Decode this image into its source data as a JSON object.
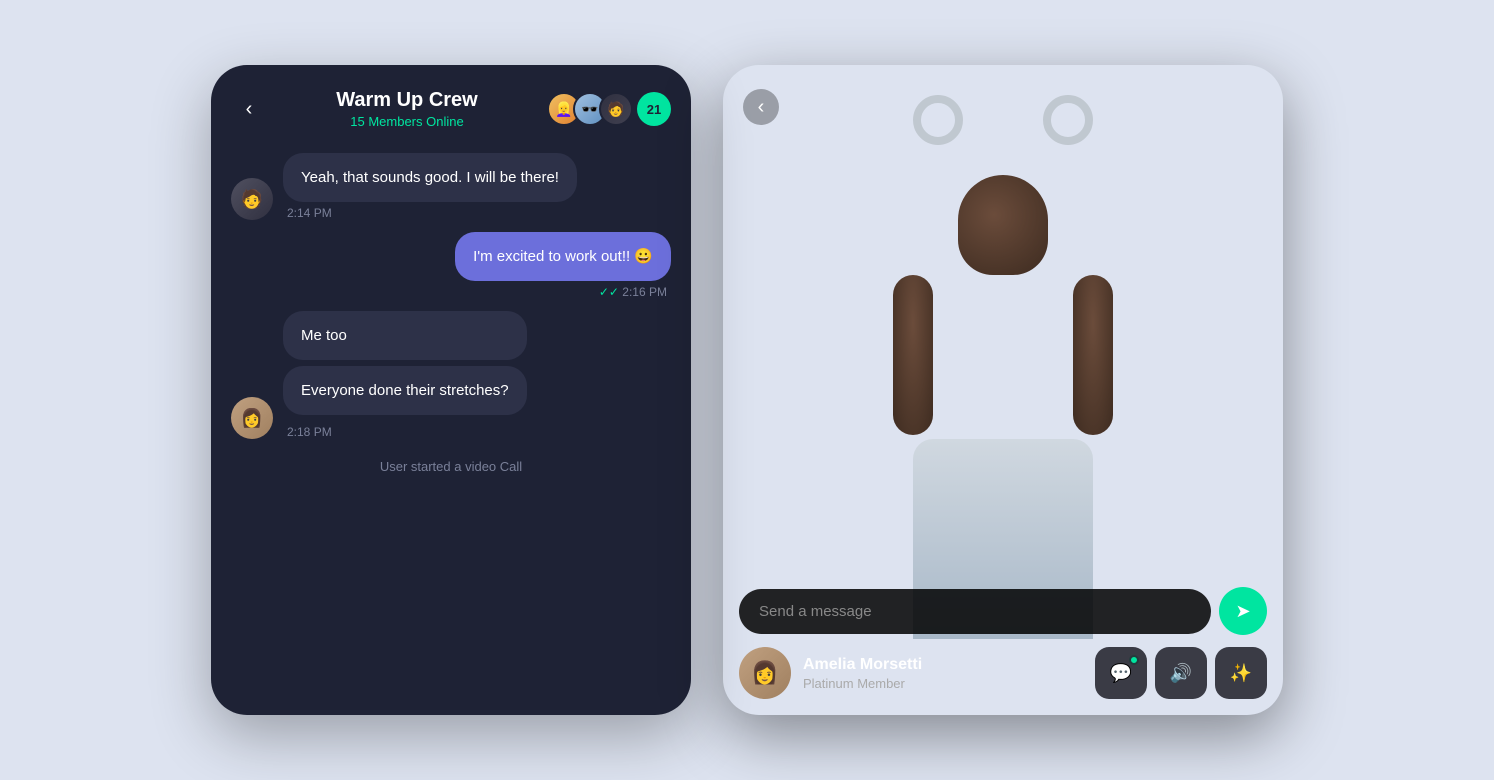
{
  "left_phone": {
    "header": {
      "back_label": "‹",
      "group_name": "Warm Up Crew",
      "members_online": "15 Members Online",
      "member_count": "21"
    },
    "messages": [
      {
        "id": "msg1",
        "sender": "other1",
        "text": "Yeah, that sounds good. I will be there!",
        "time": "2:14 PM",
        "type": "received"
      },
      {
        "id": "msg2",
        "sender": "self",
        "text": "I'm excited to work out!! 😀",
        "time": "2:16 PM",
        "type": "sent"
      },
      {
        "id": "msg3a",
        "sender": "other2",
        "text": "Me too",
        "type": "received_multi"
      },
      {
        "id": "msg3b",
        "sender": "other2",
        "text": "Everyone done their stretches?",
        "time": "2:18 PM",
        "type": "received_multi_last"
      },
      {
        "id": "sys1",
        "text": "User started a video Call",
        "type": "system"
      }
    ]
  },
  "right_phone": {
    "back_label": "‹",
    "input_placeholder": "Send a message",
    "send_icon": "➤",
    "user": {
      "name": "Amelia Morsetti",
      "rank": "Platinum Member"
    },
    "action_buttons": [
      {
        "id": "chat",
        "icon": "💬",
        "has_dot": true
      },
      {
        "id": "volume",
        "icon": "🔊",
        "has_dot": false
      },
      {
        "id": "effects",
        "icon": "✨",
        "has_dot": false
      }
    ]
  }
}
